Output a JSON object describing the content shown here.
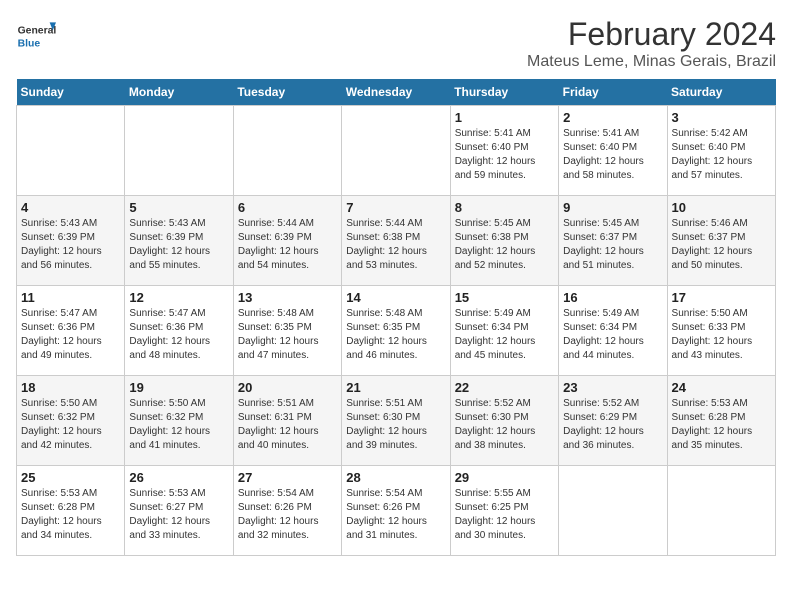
{
  "header": {
    "logo_general": "General",
    "logo_blue": "Blue",
    "month_title": "February 2024",
    "location": "Mateus Leme, Minas Gerais, Brazil"
  },
  "days_of_week": [
    "Sunday",
    "Monday",
    "Tuesday",
    "Wednesday",
    "Thursday",
    "Friday",
    "Saturday"
  ],
  "weeks": [
    [
      {
        "day": "",
        "info": ""
      },
      {
        "day": "",
        "info": ""
      },
      {
        "day": "",
        "info": ""
      },
      {
        "day": "",
        "info": ""
      },
      {
        "day": "1",
        "info": "Sunrise: 5:41 AM\nSunset: 6:40 PM\nDaylight: 12 hours and 59 minutes."
      },
      {
        "day": "2",
        "info": "Sunrise: 5:41 AM\nSunset: 6:40 PM\nDaylight: 12 hours and 58 minutes."
      },
      {
        "day": "3",
        "info": "Sunrise: 5:42 AM\nSunset: 6:40 PM\nDaylight: 12 hours and 57 minutes."
      }
    ],
    [
      {
        "day": "4",
        "info": "Sunrise: 5:43 AM\nSunset: 6:39 PM\nDaylight: 12 hours and 56 minutes."
      },
      {
        "day": "5",
        "info": "Sunrise: 5:43 AM\nSunset: 6:39 PM\nDaylight: 12 hours and 55 minutes."
      },
      {
        "day": "6",
        "info": "Sunrise: 5:44 AM\nSunset: 6:39 PM\nDaylight: 12 hours and 54 minutes."
      },
      {
        "day": "7",
        "info": "Sunrise: 5:44 AM\nSunset: 6:38 PM\nDaylight: 12 hours and 53 minutes."
      },
      {
        "day": "8",
        "info": "Sunrise: 5:45 AM\nSunset: 6:38 PM\nDaylight: 12 hours and 52 minutes."
      },
      {
        "day": "9",
        "info": "Sunrise: 5:45 AM\nSunset: 6:37 PM\nDaylight: 12 hours and 51 minutes."
      },
      {
        "day": "10",
        "info": "Sunrise: 5:46 AM\nSunset: 6:37 PM\nDaylight: 12 hours and 50 minutes."
      }
    ],
    [
      {
        "day": "11",
        "info": "Sunrise: 5:47 AM\nSunset: 6:36 PM\nDaylight: 12 hours and 49 minutes."
      },
      {
        "day": "12",
        "info": "Sunrise: 5:47 AM\nSunset: 6:36 PM\nDaylight: 12 hours and 48 minutes."
      },
      {
        "day": "13",
        "info": "Sunrise: 5:48 AM\nSunset: 6:35 PM\nDaylight: 12 hours and 47 minutes."
      },
      {
        "day": "14",
        "info": "Sunrise: 5:48 AM\nSunset: 6:35 PM\nDaylight: 12 hours and 46 minutes."
      },
      {
        "day": "15",
        "info": "Sunrise: 5:49 AM\nSunset: 6:34 PM\nDaylight: 12 hours and 45 minutes."
      },
      {
        "day": "16",
        "info": "Sunrise: 5:49 AM\nSunset: 6:34 PM\nDaylight: 12 hours and 44 minutes."
      },
      {
        "day": "17",
        "info": "Sunrise: 5:50 AM\nSunset: 6:33 PM\nDaylight: 12 hours and 43 minutes."
      }
    ],
    [
      {
        "day": "18",
        "info": "Sunrise: 5:50 AM\nSunset: 6:32 PM\nDaylight: 12 hours and 42 minutes."
      },
      {
        "day": "19",
        "info": "Sunrise: 5:50 AM\nSunset: 6:32 PM\nDaylight: 12 hours and 41 minutes."
      },
      {
        "day": "20",
        "info": "Sunrise: 5:51 AM\nSunset: 6:31 PM\nDaylight: 12 hours and 40 minutes."
      },
      {
        "day": "21",
        "info": "Sunrise: 5:51 AM\nSunset: 6:30 PM\nDaylight: 12 hours and 39 minutes."
      },
      {
        "day": "22",
        "info": "Sunrise: 5:52 AM\nSunset: 6:30 PM\nDaylight: 12 hours and 38 minutes."
      },
      {
        "day": "23",
        "info": "Sunrise: 5:52 AM\nSunset: 6:29 PM\nDaylight: 12 hours and 36 minutes."
      },
      {
        "day": "24",
        "info": "Sunrise: 5:53 AM\nSunset: 6:28 PM\nDaylight: 12 hours and 35 minutes."
      }
    ],
    [
      {
        "day": "25",
        "info": "Sunrise: 5:53 AM\nSunset: 6:28 PM\nDaylight: 12 hours and 34 minutes."
      },
      {
        "day": "26",
        "info": "Sunrise: 5:53 AM\nSunset: 6:27 PM\nDaylight: 12 hours and 33 minutes."
      },
      {
        "day": "27",
        "info": "Sunrise: 5:54 AM\nSunset: 6:26 PM\nDaylight: 12 hours and 32 minutes."
      },
      {
        "day": "28",
        "info": "Sunrise: 5:54 AM\nSunset: 6:26 PM\nDaylight: 12 hours and 31 minutes."
      },
      {
        "day": "29",
        "info": "Sunrise: 5:55 AM\nSunset: 6:25 PM\nDaylight: 12 hours and 30 minutes."
      },
      {
        "day": "",
        "info": ""
      },
      {
        "day": "",
        "info": ""
      }
    ]
  ]
}
